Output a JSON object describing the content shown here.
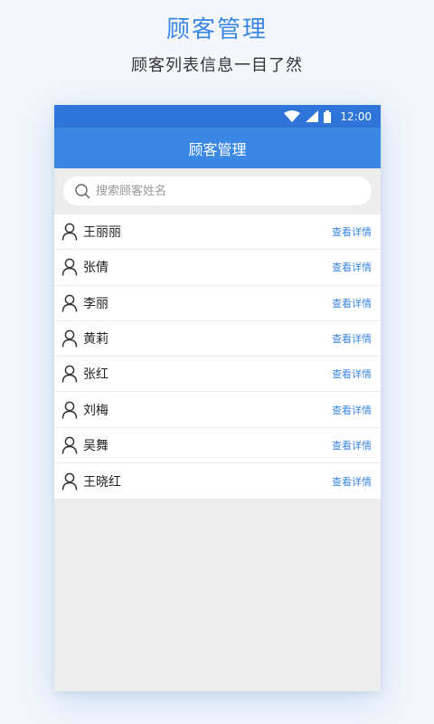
{
  "promo": {
    "title": "顾客管理",
    "subtitle": "顾客列表信息一目了然"
  },
  "status_bar": {
    "time": "12:00",
    "icons": [
      "wifi-icon",
      "signal-icon",
      "battery-icon"
    ]
  },
  "app_bar": {
    "title": "顾客管理"
  },
  "search": {
    "placeholder": "搜索顾客姓名",
    "value": ""
  },
  "customers": [
    {
      "name": "王丽丽",
      "action": "查看详情"
    },
    {
      "name": "张倩",
      "action": "查看详情"
    },
    {
      "name": "李丽",
      "action": "查看详情"
    },
    {
      "name": "黄莉",
      "action": "查看详情"
    },
    {
      "name": "张红",
      "action": "查看详情"
    },
    {
      "name": "刘梅",
      "action": "查看详情"
    },
    {
      "name": "吴舞",
      "action": "查看详情"
    },
    {
      "name": "王晓红",
      "action": "查看详情"
    }
  ],
  "colors": {
    "accent": "#3a87e4",
    "status_bar": "#2f74d8",
    "background": "#ededed"
  }
}
